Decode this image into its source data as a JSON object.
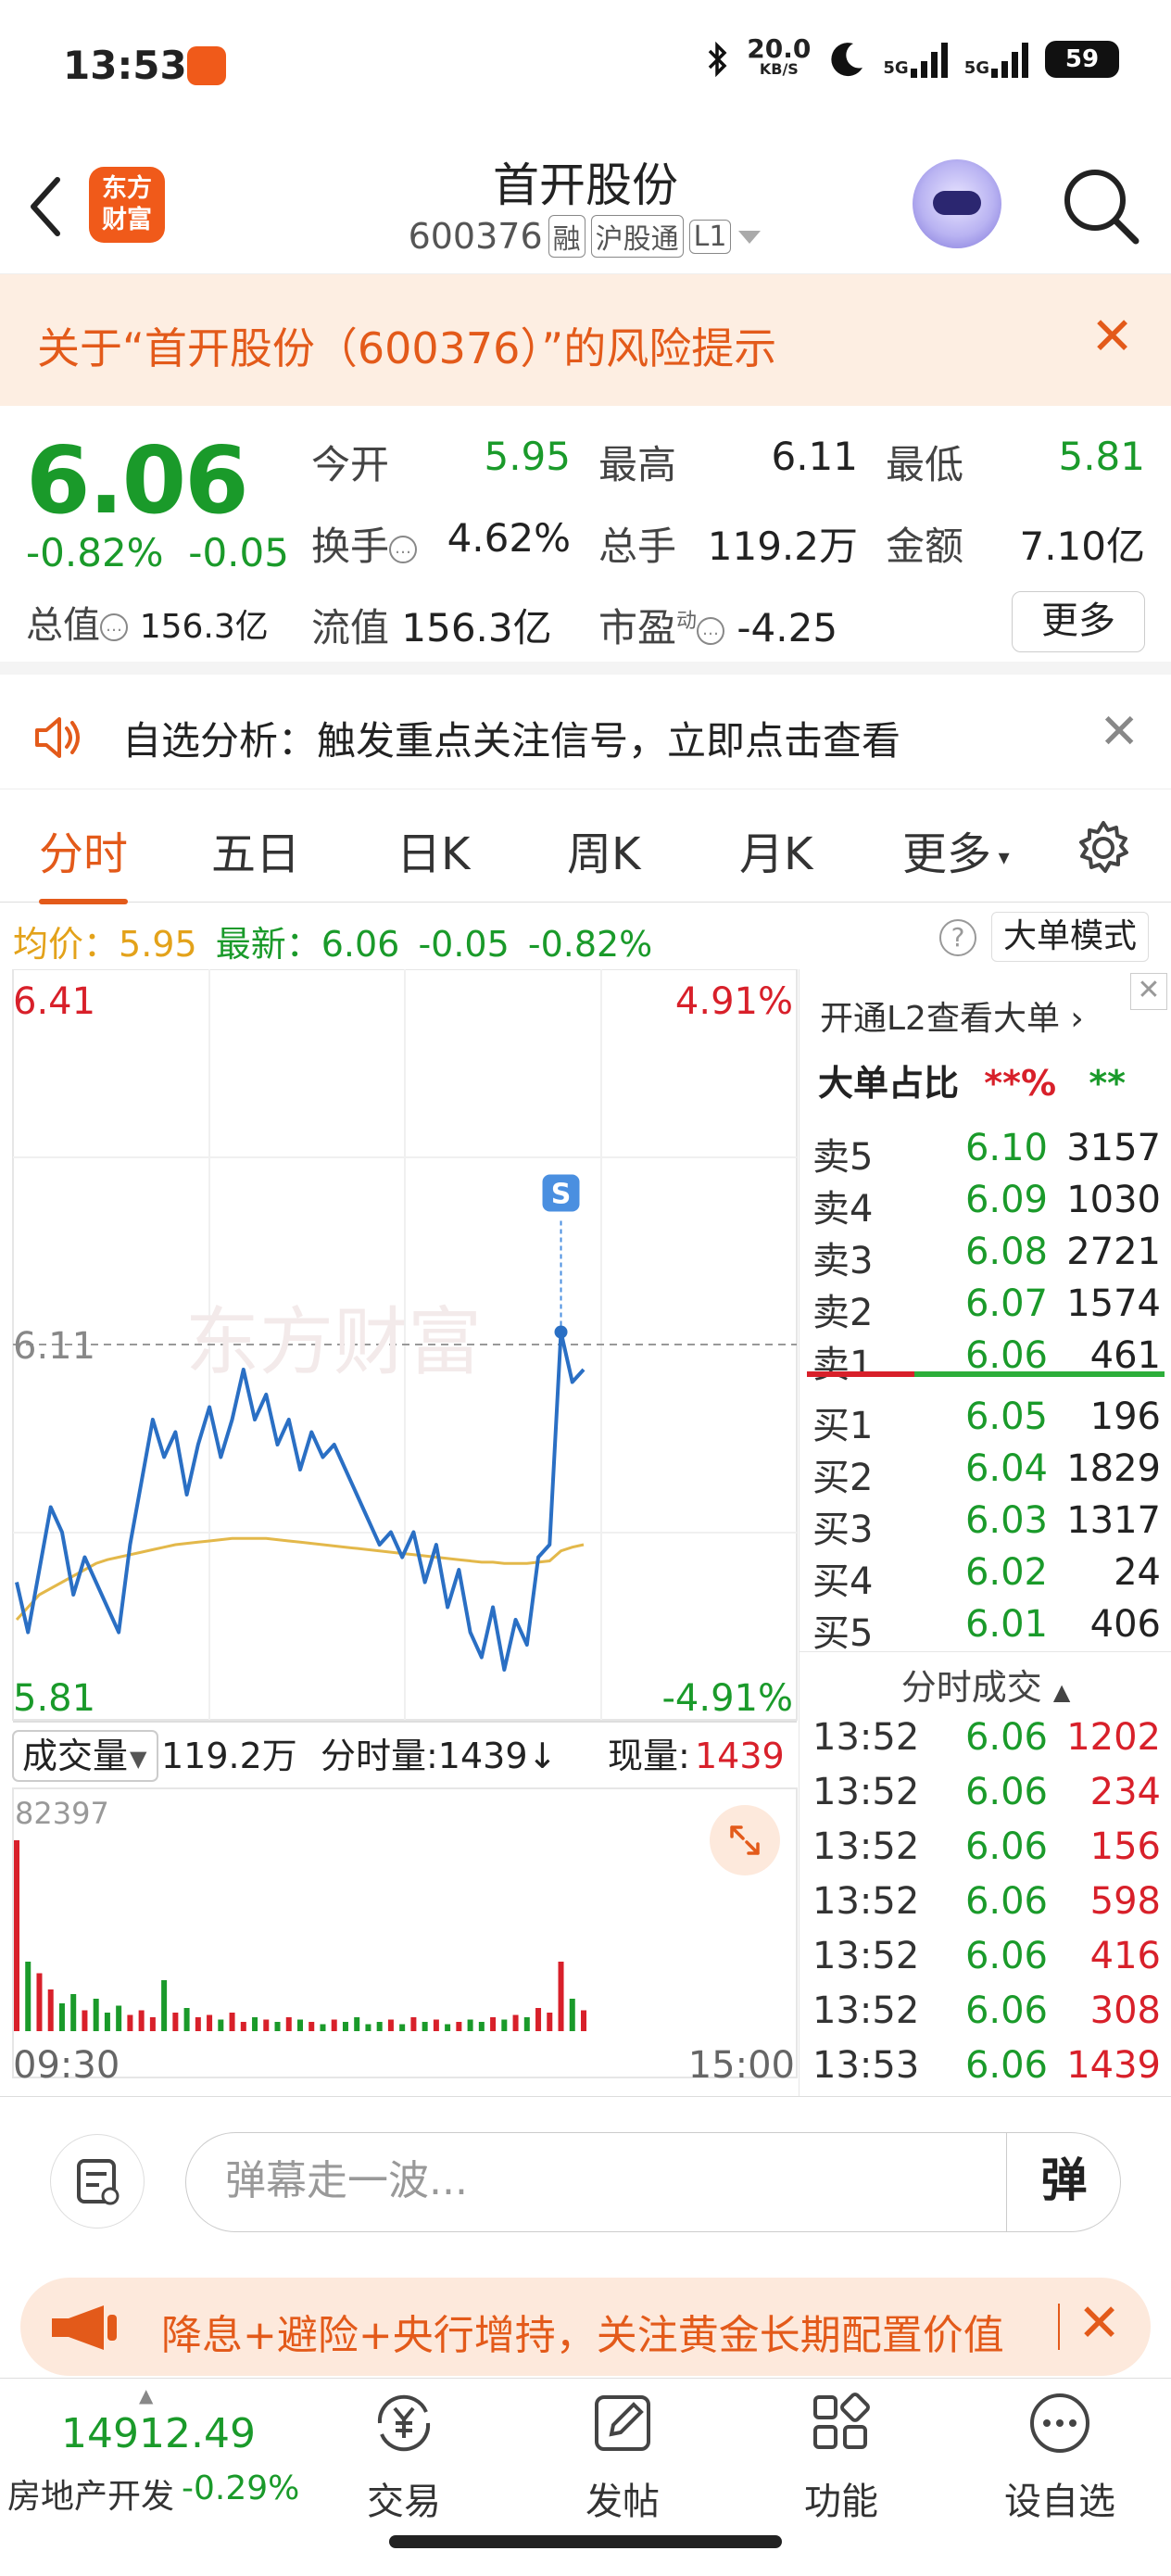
{
  "status_bar": {
    "time": "13:53",
    "net_speed": "20.0",
    "net_unit": "KB/S",
    "sig1": "5G",
    "sig2": "5G",
    "battery": "59"
  },
  "header": {
    "logo_line1": "东方",
    "logo_line2": "财富",
    "title": "首开股份",
    "code": "600376",
    "tags": [
      "融",
      "沪股通",
      "L1"
    ]
  },
  "risk_banner": {
    "text": "关于“首开股份（600376）”的风险提示"
  },
  "quote": {
    "price": "6.06",
    "change_pct": "-0.82%",
    "change": "-0.05",
    "open_label": "今开",
    "open": "5.95",
    "high_label": "最高",
    "high": "6.11",
    "low_label": "最低",
    "low": "5.81",
    "turnover_label": "换手",
    "turnover": "4.62%",
    "volume_label": "总手",
    "volume": "119.2万",
    "amount_label": "金额",
    "amount": "7.10亿",
    "mktcap_label": "总值",
    "mktcap": "156.3亿",
    "float_label": "流值",
    "float": "156.3亿",
    "pe_label": "市盈",
    "pe_sup": "动",
    "pe": "-4.25",
    "more_label": "更多"
  },
  "analysis": {
    "text": "自选分析：触发重点关注信号，立即点击查看"
  },
  "tabs": [
    "分时",
    "五日",
    "日K",
    "周K",
    "月K",
    "更多"
  ],
  "avg_bar": {
    "avg_label": "均价：",
    "avg": "5.95",
    "latest_label": "最新：",
    "latest": "6.06",
    "chg": "-0.05",
    "pct": "-0.82%",
    "mode_label": "大单模式"
  },
  "chart_data": {
    "type": "line",
    "y_top": "6.41",
    "y_top_pct": "4.91%",
    "y_mid": "6.11",
    "y_bottom": "5.81",
    "y_bottom_pct": "-4.91%",
    "ylim": [
      5.81,
      6.41
    ],
    "watermark": "东方财富",
    "marker": "S",
    "price": [
      5.92,
      5.88,
      5.93,
      5.98,
      5.96,
      5.91,
      5.94,
      5.92,
      5.9,
      5.88,
      5.95,
      6.0,
      6.05,
      6.02,
      6.04,
      5.99,
      6.03,
      6.06,
      6.02,
      6.05,
      6.09,
      6.05,
      6.07,
      6.03,
      6.05,
      6.01,
      6.04,
      6.02,
      6.03,
      6.01,
      5.99,
      5.97,
      5.95,
      5.96,
      5.94,
      5.96,
      5.92,
      5.95,
      5.9,
      5.93,
      5.88,
      5.86,
      5.9,
      5.85,
      5.89,
      5.87,
      5.94,
      5.95,
      6.12,
      6.08,
      6.09
    ],
    "avg": [
      5.89,
      5.9,
      5.91,
      5.915,
      5.92,
      5.925,
      5.93,
      5.935,
      5.938,
      5.94,
      5.942,
      5.944,
      5.946,
      5.948,
      5.95,
      5.951,
      5.952,
      5.953,
      5.954,
      5.955,
      5.955,
      5.955,
      5.955,
      5.954,
      5.953,
      5.952,
      5.951,
      5.95,
      5.949,
      5.948,
      5.947,
      5.946,
      5.945,
      5.944,
      5.943,
      5.942,
      5.941,
      5.94,
      5.939,
      5.938,
      5.937,
      5.936,
      5.936,
      5.935,
      5.935,
      5.935,
      5.936,
      5.937,
      5.945,
      5.948,
      5.95
    ],
    "volume_label": "成交量",
    "volume_total": "119.2万",
    "minute_vol_label": "分时量:1439↓",
    "current_vol_label": "现量:",
    "current_vol": "1439",
    "vol_max": "82397",
    "volumes": [
      82397,
      30000,
      25000,
      18000,
      12000,
      16000,
      9000,
      14000,
      8000,
      11000,
      7000,
      9000,
      6000,
      22000,
      8000,
      10000,
      6000,
      7000,
      5000,
      8000,
      4000,
      6000,
      5000,
      4000,
      6000,
      5000,
      4000,
      3000,
      5000,
      4000,
      6000,
      3000,
      4000,
      5000,
      3000,
      6000,
      4000,
      5000,
      3000,
      4000,
      5000,
      4000,
      6000,
      5000,
      7000,
      6000,
      10000,
      8000,
      30000,
      14000,
      9000
    ],
    "x_start": "09:30",
    "x_end": "15:00"
  },
  "order_book": {
    "l2_label": "开通L2查看大单",
    "big_ratio_label": "大单占比",
    "big_ratio_sell": "**%",
    "big_ratio_buy": "**",
    "asks": [
      {
        "name": "卖5",
        "price": "6.10",
        "vol": "3157"
      },
      {
        "name": "卖4",
        "price": "6.09",
        "vol": "1030"
      },
      {
        "name": "卖3",
        "price": "6.08",
        "vol": "2721"
      },
      {
        "name": "卖2",
        "price": "6.07",
        "vol": "1574"
      },
      {
        "name": "卖1",
        "price": "6.06",
        "vol": "461"
      }
    ],
    "bids": [
      {
        "name": "买1",
        "price": "6.05",
        "vol": "196"
      },
      {
        "name": "买2",
        "price": "6.04",
        "vol": "1829"
      },
      {
        "name": "买3",
        "price": "6.03",
        "vol": "1317"
      },
      {
        "name": "买4",
        "price": "6.02",
        "vol": "24"
      },
      {
        "name": "买5",
        "price": "6.01",
        "vol": "406"
      }
    ],
    "trades_label": "分时成交",
    "trades": [
      {
        "time": "13:52",
        "price": "6.06",
        "vol": "1202"
      },
      {
        "time": "13:52",
        "price": "6.06",
        "vol": "234"
      },
      {
        "time": "13:52",
        "price": "6.06",
        "vol": "156"
      },
      {
        "time": "13:52",
        "price": "6.06",
        "vol": "598"
      },
      {
        "time": "13:52",
        "price": "6.06",
        "vol": "416"
      },
      {
        "time": "13:52",
        "price": "6.06",
        "vol": "308"
      },
      {
        "time": "13:53",
        "price": "6.06",
        "vol": "1439"
      }
    ]
  },
  "comment": {
    "placeholder": "弹幕走一波...",
    "dan_label": "弹"
  },
  "promo": {
    "text": "降息+避险+央行增持，关注黄金长期配置价值"
  },
  "bottom_nav": {
    "index_value": "14912.49",
    "index_name": "房地产开发",
    "index_change": "-0.29%",
    "items": [
      "交易",
      "发帖",
      "功能",
      "设自选"
    ]
  },
  "colors": {
    "accent": "#e35a1a",
    "up": "#d8202a",
    "down": "#1a9a2a",
    "avg_line": "#e3b84a",
    "price_line": "#2a6fc4"
  }
}
